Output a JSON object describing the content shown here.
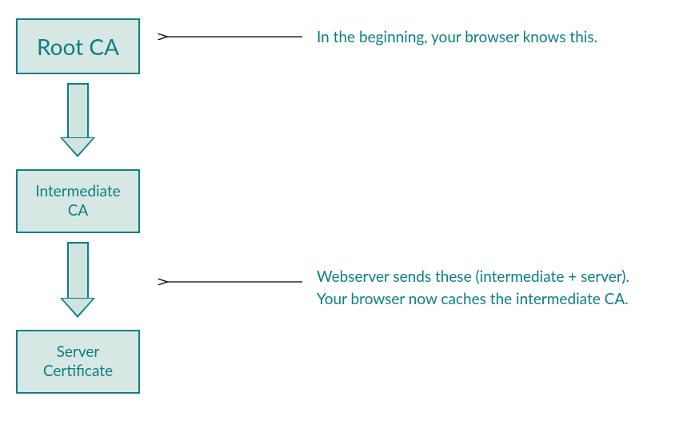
{
  "boxes": {
    "root": "Root CA",
    "intermediate_line1": "Intermediate",
    "intermediate_line2": "CA",
    "server_line1": "Server",
    "server_line2": "Certificate"
  },
  "annotations": {
    "a1": "In the beginning, your browser knows this.",
    "a2_line1": "Webserver sends these (intermediate + server).",
    "a2_line2": "Your browser now caches the intermediate CA."
  }
}
